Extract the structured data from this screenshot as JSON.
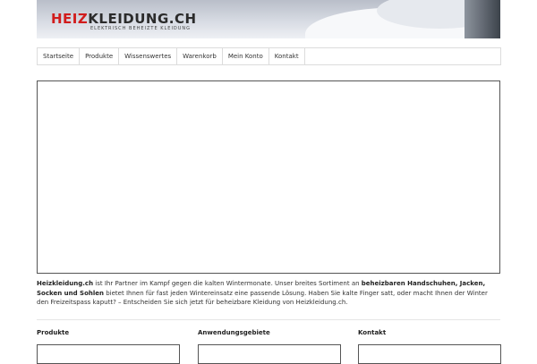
{
  "banner": {
    "logo_red": "HEIZ",
    "logo_dark": "KLEIDUNG.CH",
    "tagline": "ELEKTRISCH BEHEIZTE KLEIDUNG"
  },
  "nav": {
    "items": [
      "Startseite",
      "Produkte",
      "Wissenswertes",
      "Warenkorb",
      "Mein Konto",
      "Kontakt"
    ]
  },
  "intro": {
    "p1_b": "Heizkleidung.ch",
    "p2": " ist Ihr Partner im Kampf gegen die kalten Wintermonate. Unser breites Sortiment an ",
    "p3_b": "beheizbaren Handschuhen, Jacken, Socken und Sohlen",
    "p4": " bietet Ihnen für fast jeden Wintereinsatz eine passende Lösung. Haben Sie kalte Finger satt, oder macht Ihnen der Winter den Freizeitspass kaputt? – Entscheiden Sie sich jetzt für beheizbare Kleidung von Heizkleidung.ch."
  },
  "columns": {
    "produkte": "Produkte",
    "anwendungsgebiete": "Anwendungsgebiete",
    "kontakt": "Kontakt"
  }
}
